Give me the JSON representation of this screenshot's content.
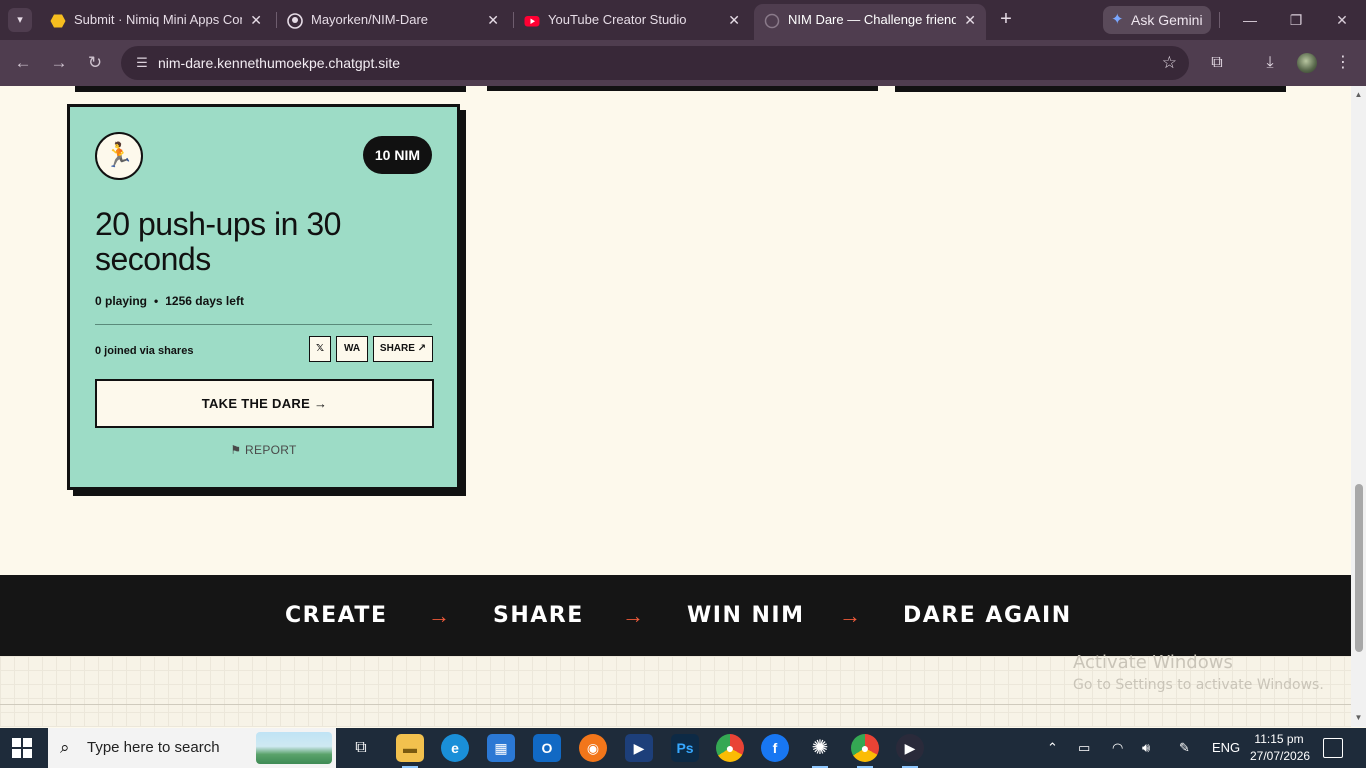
{
  "browser": {
    "tabs": [
      {
        "title": "Submit · Nimiq Mini Apps Comp",
        "icon": "nimiq-hexagon-icon",
        "active": false
      },
      {
        "title": "Mayorken/NIM-Dare",
        "icon": "github-icon",
        "active": false
      },
      {
        "title": "YouTube Creator Studio",
        "icon": "youtube-icon",
        "active": false
      },
      {
        "title": "NIM Dare — Challenge friends",
        "icon": "globe-icon",
        "active": true
      }
    ],
    "ask_gemini": "Ask Gemini",
    "url": "nim-dare.kennethumoekpe.chatgpt.site"
  },
  "card": {
    "emoji": "🏃",
    "reward": "10 NIM",
    "title": "20 push-ups in 30 seconds",
    "playing": "0 playing",
    "separator": "•",
    "days_left": "1256 days left",
    "joined": "0 joined via shares",
    "share_x": "𝕏",
    "share_wa": "WA",
    "share_more": "SHARE ↗",
    "take_dare": "TAKE THE DARE →",
    "report": "⚑ REPORT"
  },
  "steps": {
    "items": [
      "CREATE",
      "SHARE",
      "WIN NIM",
      "DARE AGAIN"
    ],
    "arrow": "→",
    "arrow_color": "#ef5a3a"
  },
  "watermark": {
    "line1": "Activate Windows",
    "line2": "Go to Settings to activate Windows."
  },
  "taskbar": {
    "search_placeholder": "Type here to search",
    "apps": [
      "task-view",
      "file-explorer",
      "edge",
      "microsoft-store",
      "outlook",
      "firefox",
      "zoom",
      "photoshop",
      "chrome",
      "facebook",
      "chatgpt",
      "chrome-profile",
      "media-player"
    ],
    "language": "ENG",
    "time": "11:15 pm",
    "date": "27/07/2026"
  },
  "colors": {
    "card_bg": "#9ddcc6",
    "page_bg": "#fdf9ec",
    "band_bg": "#151515",
    "chrome_bg": "#3b2b3b"
  }
}
